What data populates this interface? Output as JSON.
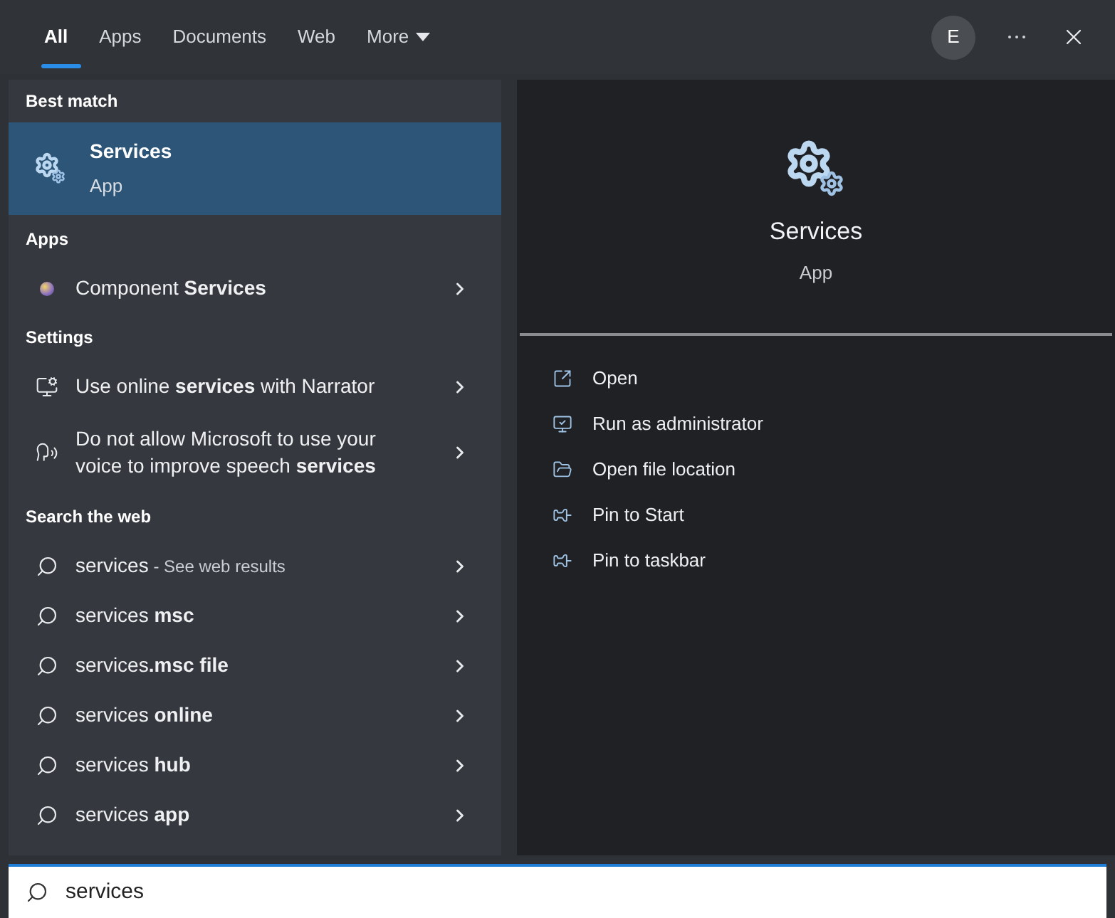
{
  "tabs": [
    {
      "label": "All",
      "selected": true,
      "kind": "tab"
    },
    {
      "label": "Apps",
      "selected": false,
      "kind": "tab"
    },
    {
      "label": "Documents",
      "selected": false,
      "kind": "tab"
    },
    {
      "label": "Web",
      "selected": false,
      "kind": "tab"
    },
    {
      "label": "More",
      "selected": false,
      "kind": "menu"
    }
  ],
  "account": {
    "initial": "E"
  },
  "sections": [
    {
      "heading": "Best match",
      "items": [
        {
          "kind": "best",
          "text": "Services",
          "subtitle": "App",
          "selected": true
        }
      ]
    },
    {
      "heading": "Apps",
      "items": [
        {
          "kind": "app",
          "text": "Component **Services**",
          "selected": false
        }
      ]
    },
    {
      "heading": "Settings",
      "items": [
        {
          "kind": "setting",
          "text": "Use online **services** with Narrator",
          "selected": false
        },
        {
          "kind": "setting",
          "text": "Do not allow Microsoft to use your voice to improve speech **services**",
          "selected": false
        }
      ]
    },
    {
      "heading": "Search the web",
      "items": [
        {
          "kind": "web",
          "text": "services",
          "note": "- See web results",
          "selected": false
        },
        {
          "kind": "web",
          "text": "services **msc**",
          "selected": false
        },
        {
          "kind": "web",
          "text": "services**.msc file**",
          "selected": false
        },
        {
          "kind": "web",
          "text": "services **online**",
          "selected": false
        },
        {
          "kind": "web",
          "text": "services **hub**",
          "selected": false
        },
        {
          "kind": "web",
          "text": "services **app**",
          "selected": false
        }
      ]
    }
  ],
  "preview": {
    "title": "Services",
    "subtitle": "App",
    "actions": [
      {
        "label": "Open"
      },
      {
        "label": "Run as administrator"
      },
      {
        "label": "Open file location"
      },
      {
        "label": "Pin to Start"
      },
      {
        "label": "Pin to taskbar"
      }
    ]
  },
  "search": {
    "value": "services"
  }
}
